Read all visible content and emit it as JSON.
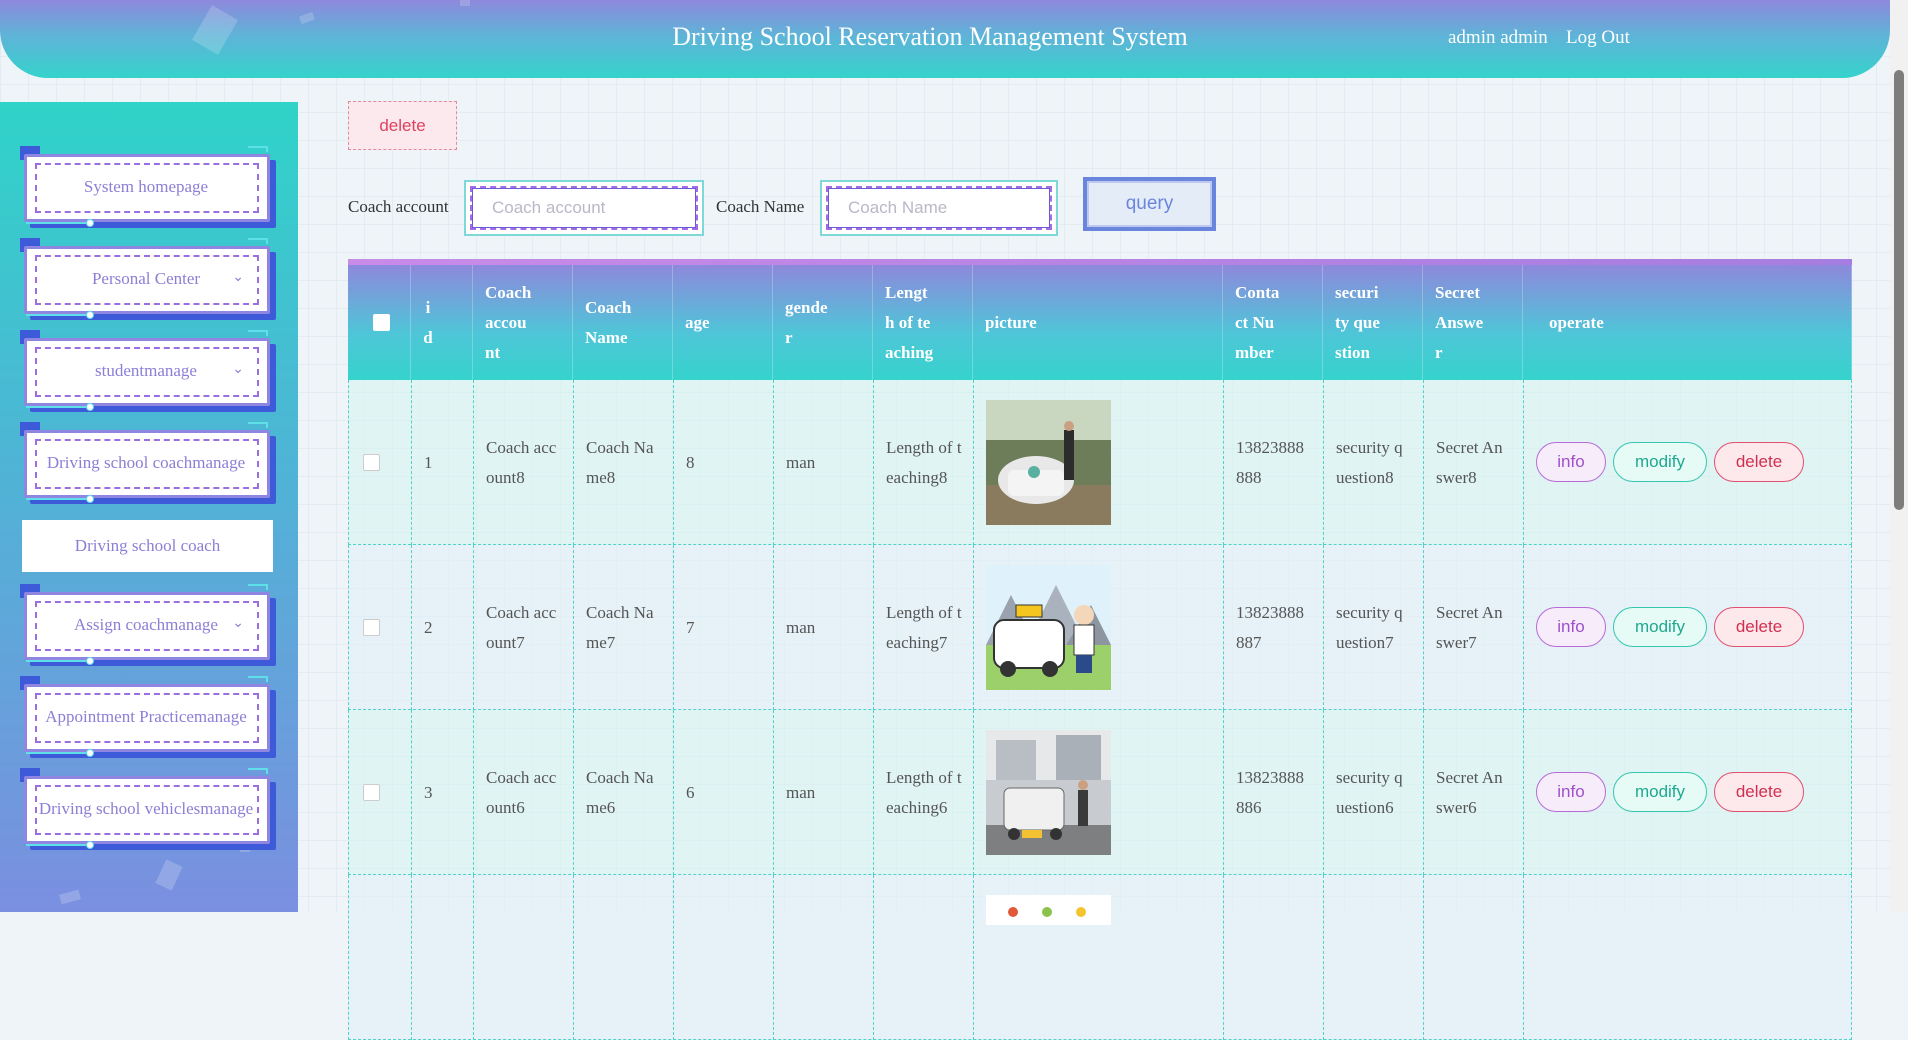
{
  "header": {
    "title": "Driving School Reservation Management System",
    "user": "admin admin",
    "logout": "Log Out"
  },
  "sidebar": {
    "items": [
      {
        "label": "System homepage",
        "has_chevron": false
      },
      {
        "label": "Personal Center",
        "has_chevron": true
      },
      {
        "label": "studentmanage",
        "has_chevron": true
      },
      {
        "label": "Driving school coachmanage",
        "has_chevron": false
      },
      {
        "label": "Assign coachmanage",
        "has_chevron": true
      },
      {
        "label": "Appointment Practicemanage",
        "has_chevron": false
      },
      {
        "label": "Driving school vehiclesmanage",
        "has_chevron": false
      }
    ],
    "active_sub": "Driving school coach"
  },
  "toolbar": {
    "delete_label": "delete"
  },
  "search": {
    "account_label": "Coach account",
    "account_placeholder": "Coach account",
    "name_label": "Coach Name",
    "name_placeholder": "Coach Name",
    "query_label": "query"
  },
  "table": {
    "headers": [
      "i d",
      "Coach accou nt",
      "Coach Name",
      "age",
      "gende r",
      "Lengt h of te aching",
      "picture",
      "Conta ct Nu mber",
      "securi ty que stion",
      "Secret Answe r",
      "operate"
    ],
    "rows": [
      {
        "id": "1",
        "account": "Coach acc ount8",
        "name": "Coach Na me8",
        "age": "8",
        "gender": "man",
        "length": "Length of teaching8",
        "phone": "13823888 888",
        "question": "security q uestion8",
        "answer": "Secret An swer8"
      },
      {
        "id": "2",
        "account": "Coach acc ount7",
        "name": "Coach Na me7",
        "age": "7",
        "gender": "man",
        "length": "Length of teaching7",
        "phone": "13823888 887",
        "question": "security q uestion7",
        "answer": "Secret An swer7"
      },
      {
        "id": "3",
        "account": "Coach acc ount6",
        "name": "Coach Na me6",
        "age": "6",
        "gender": "man",
        "length": "Length of teaching6",
        "phone": "13823888 886",
        "question": "security q uestion6",
        "answer": "Secret An swer6"
      }
    ],
    "ops": {
      "info": "info",
      "modify": "modify",
      "delete": "delete"
    }
  },
  "colors": {
    "header_gradient_top": "#8e88dc",
    "header_gradient_bottom": "#35d3cc",
    "accent_purple": "#8b7fd6",
    "accent_teal": "#35d3cc",
    "delete_red": "#d03050"
  }
}
